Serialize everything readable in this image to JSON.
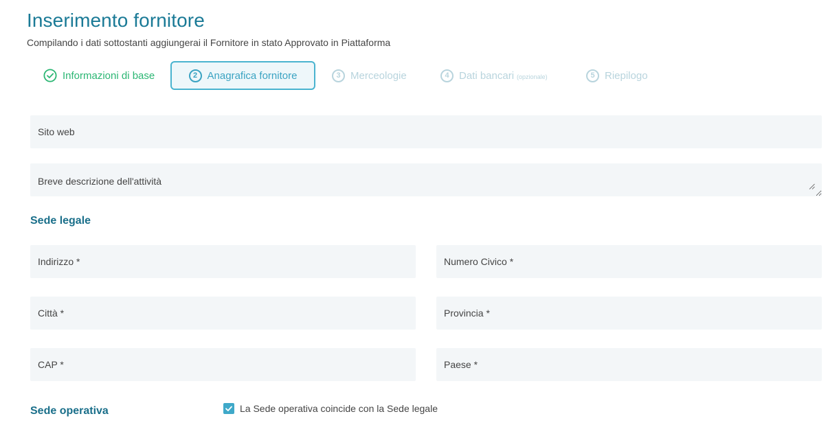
{
  "header": {
    "title": "Inserimento fornitore",
    "subtitle": "Compilando i dati sottostanti aggiungerai il Fornitore in stato Approvato in Piattaforma"
  },
  "stepper": {
    "steps": [
      {
        "number": "1",
        "label": "Informazioni di base",
        "state": "completed"
      },
      {
        "number": "2",
        "label": "Anagrafica fornitore",
        "state": "active"
      },
      {
        "number": "3",
        "label": "Merceologie",
        "state": "pending"
      },
      {
        "number": "4",
        "label": "Dati bancari",
        "note": "(opzionale)",
        "state": "pending"
      },
      {
        "number": "5",
        "label": "Riepilogo",
        "state": "pending"
      }
    ]
  },
  "form": {
    "website": {
      "placeholder": "Sito web",
      "value": ""
    },
    "description": {
      "placeholder": "Breve descrizione dell'attività",
      "value": ""
    },
    "legal_office": {
      "title": "Sede legale",
      "address": {
        "placeholder": "Indirizzo *",
        "value": ""
      },
      "street_number": {
        "placeholder": "Numero Civico *",
        "value": ""
      },
      "city": {
        "placeholder": "Città *",
        "value": ""
      },
      "province": {
        "placeholder": "Provincia *",
        "value": ""
      },
      "zip": {
        "placeholder": "CAP *",
        "value": ""
      },
      "country": {
        "placeholder": "Paese *",
        "value": ""
      }
    },
    "operating_office": {
      "title": "Sede operativa",
      "same_as_legal_label": "La Sede operativa coincide con la Sede legale",
      "same_as_legal_checked": true
    }
  },
  "colors": {
    "title": "#1a7a96",
    "completed": "#2bb673",
    "active": "#3aa3c2",
    "pending": "#b8d4dd",
    "field_bg": "#f3f6f8",
    "checkbox": "#3fa9c9"
  },
  "icons": {
    "completed_step": "check-circle-icon",
    "checkbox": "checkmark-icon",
    "resize": "resize-grip-icon"
  }
}
